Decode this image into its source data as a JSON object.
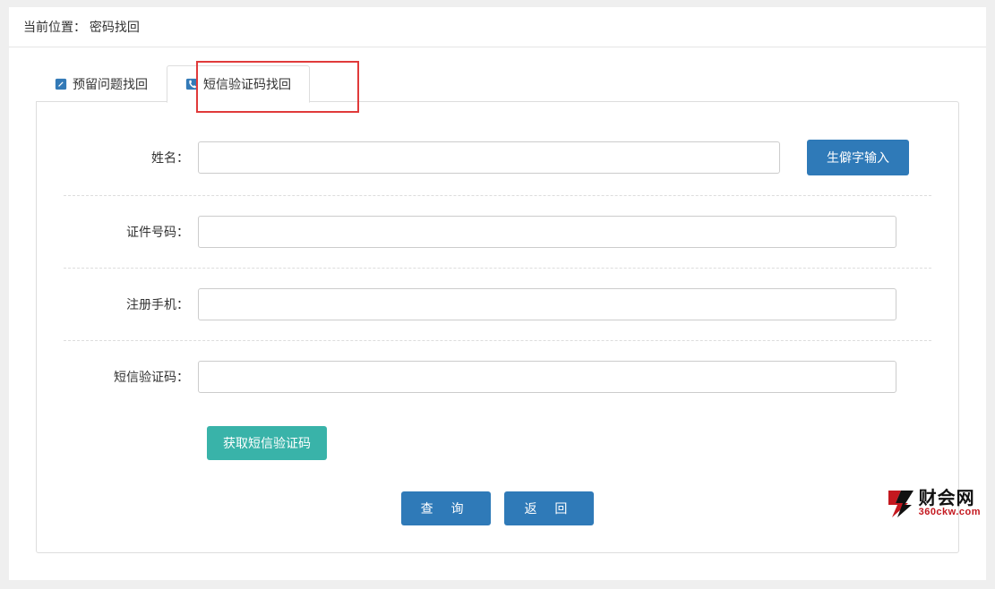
{
  "breadcrumb": {
    "label": "当前位置：",
    "current": "密码找回"
  },
  "tabs": {
    "question": "预留问题找回",
    "sms": "短信验证码找回"
  },
  "form": {
    "name_label": "姓名：",
    "rare_char_btn": "生僻字输入",
    "id_label": "证件号码：",
    "phone_label": "注册手机：",
    "sms_label": "短信验证码：",
    "get_code_btn": "获取短信验证码",
    "query_btn": "查 询",
    "back_btn": "返 回"
  },
  "watermark": {
    "line1": "财会网",
    "line2": "360ckw.com"
  }
}
